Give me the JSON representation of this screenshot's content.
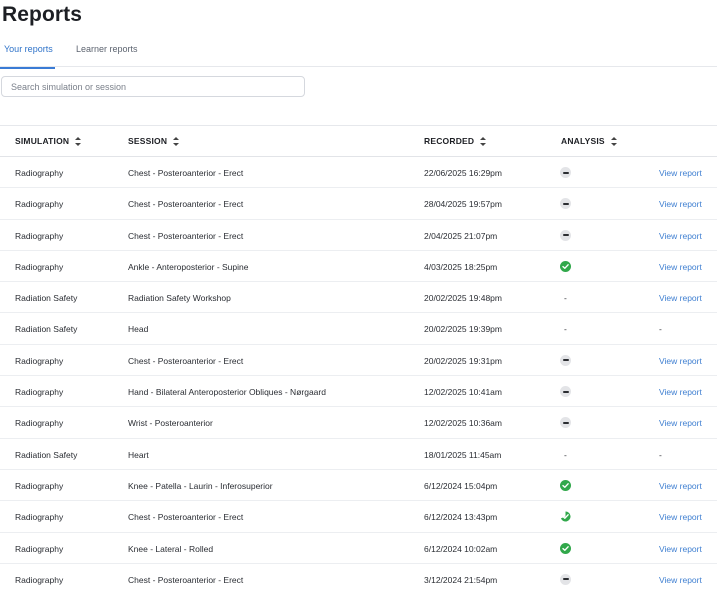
{
  "page": {
    "title": "Reports"
  },
  "tabs": [
    {
      "label": "Your reports",
      "active": true
    },
    {
      "label": "Learner reports",
      "active": false
    }
  ],
  "search": {
    "placeholder": "Search simulation or session",
    "value": ""
  },
  "colors": {
    "accent": "#3a7bd5",
    "success": "#31a84b",
    "neutral": "#e3e4e7"
  },
  "table": {
    "headers": {
      "simulation": "SIMULATION",
      "session": "SESSION",
      "recorded": "RECORDED",
      "analysis": "ANALYSIS"
    },
    "rows": [
      {
        "simulation": "Radiography",
        "session": "Chest - Posteroanterior - Erect",
        "recorded": "22/06/2025 16:29pm",
        "analysis": "none-icon",
        "action": "View report"
      },
      {
        "simulation": "Radiography",
        "session": "Chest - Posteroanterior - Erect",
        "recorded": "28/04/2025 19:57pm",
        "analysis": "none-icon",
        "action": "View report"
      },
      {
        "simulation": "Radiography",
        "session": "Chest - Posteroanterior - Erect",
        "recorded": "2/04/2025 21:07pm",
        "analysis": "none-icon",
        "action": "View report"
      },
      {
        "simulation": "Radiography",
        "session": "Ankle - Anteroposterior - Supine",
        "recorded": "4/03/2025 18:25pm",
        "analysis": "check-icon",
        "action": "View report"
      },
      {
        "simulation": "Radiation Safety",
        "session": "Radiation Safety Workshop",
        "recorded": "20/02/2025 19:48pm",
        "analysis": "-",
        "action": "View report"
      },
      {
        "simulation": "Radiation Safety",
        "session": "Head",
        "recorded": "20/02/2025 19:39pm",
        "analysis": "-",
        "action": "-"
      },
      {
        "simulation": "Radiography",
        "session": "Chest - Posteroanterior - Erect",
        "recorded": "20/02/2025 19:31pm",
        "analysis": "none-icon",
        "action": "View report"
      },
      {
        "simulation": "Radiography",
        "session": "Hand - Bilateral Anteroposterior Obliques - Nørgaard",
        "recorded": "12/02/2025 10:41am",
        "analysis": "none-icon",
        "action": "View report"
      },
      {
        "simulation": "Radiography",
        "session": "Wrist - Posteroanterior",
        "recorded": "12/02/2025 10:36am",
        "analysis": "none-icon",
        "action": "View report"
      },
      {
        "simulation": "Radiation Safety",
        "session": "Heart",
        "recorded": "18/01/2025 11:45am",
        "analysis": "-",
        "action": "-"
      },
      {
        "simulation": "Radiography",
        "session": "Knee - Patella - Laurin - Inferosuperior",
        "recorded": "6/12/2024 15:04pm",
        "analysis": "check-icon",
        "action": "View report"
      },
      {
        "simulation": "Radiography",
        "session": "Chest - Posteroanterior - Erect",
        "recorded": "6/12/2024 13:43pm",
        "analysis": "partial-icon",
        "action": "View report"
      },
      {
        "simulation": "Radiography",
        "session": "Knee - Lateral - Rolled",
        "recorded": "6/12/2024 10:02am",
        "analysis": "check-icon",
        "action": "View report"
      },
      {
        "simulation": "Radiography",
        "session": "Chest - Posteroanterior - Erect",
        "recorded": "3/12/2024 21:54pm",
        "analysis": "none-icon",
        "action": "View report"
      }
    ]
  }
}
